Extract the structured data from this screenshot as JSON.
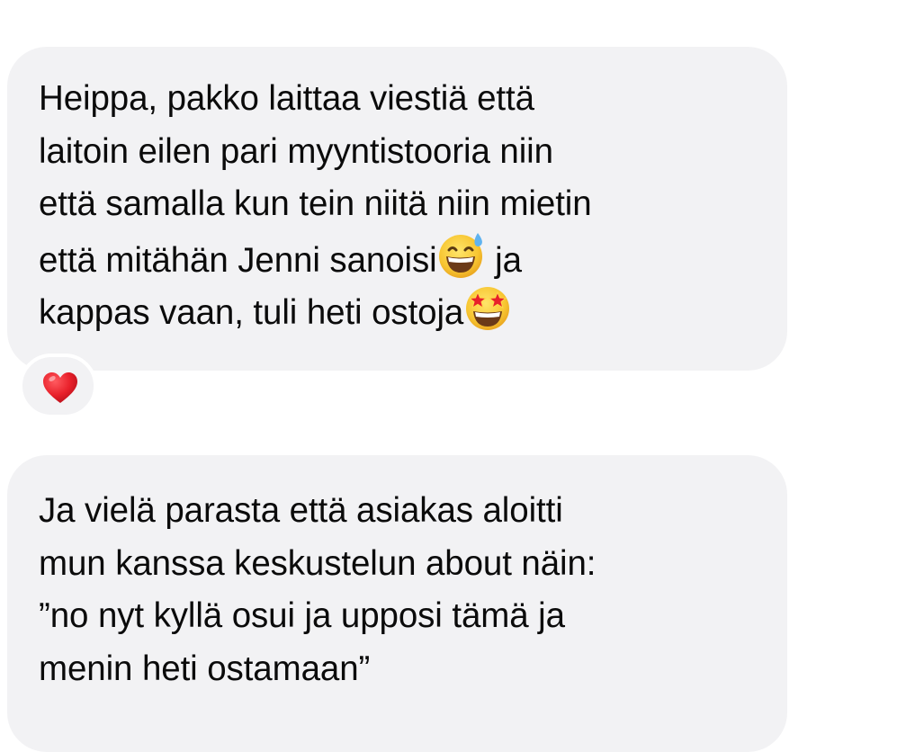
{
  "messages": [
    {
      "lines": [
        "Heippa, pakko laittaa viestiä että",
        "laitoin eilen pari myyntistooria niin",
        "että samalla kun tein niitä niin mietin"
      ],
      "line4": {
        "before": "että mitähän Jenni sanoisi",
        "emoji": "grinning-sweat-icon",
        "after": " ja"
      },
      "line5": {
        "before": "kappas vaan, tuli heti ostoja",
        "emoji": "star-struck-icon"
      },
      "reaction": {
        "icon": "red-heart-icon",
        "color": "#e8202a"
      }
    },
    {
      "lines": [
        "Ja vielä parasta että asiakas aloitti",
        "mun kanssa keskustelun about näin:",
        "”no nyt kyllä osui ja upposi tämä ja",
        "menin heti ostamaan”"
      ]
    }
  ],
  "colors": {
    "bubble_bg": "#f2f2f4",
    "text": "#0b0b0b",
    "background": "#ffffff"
  }
}
